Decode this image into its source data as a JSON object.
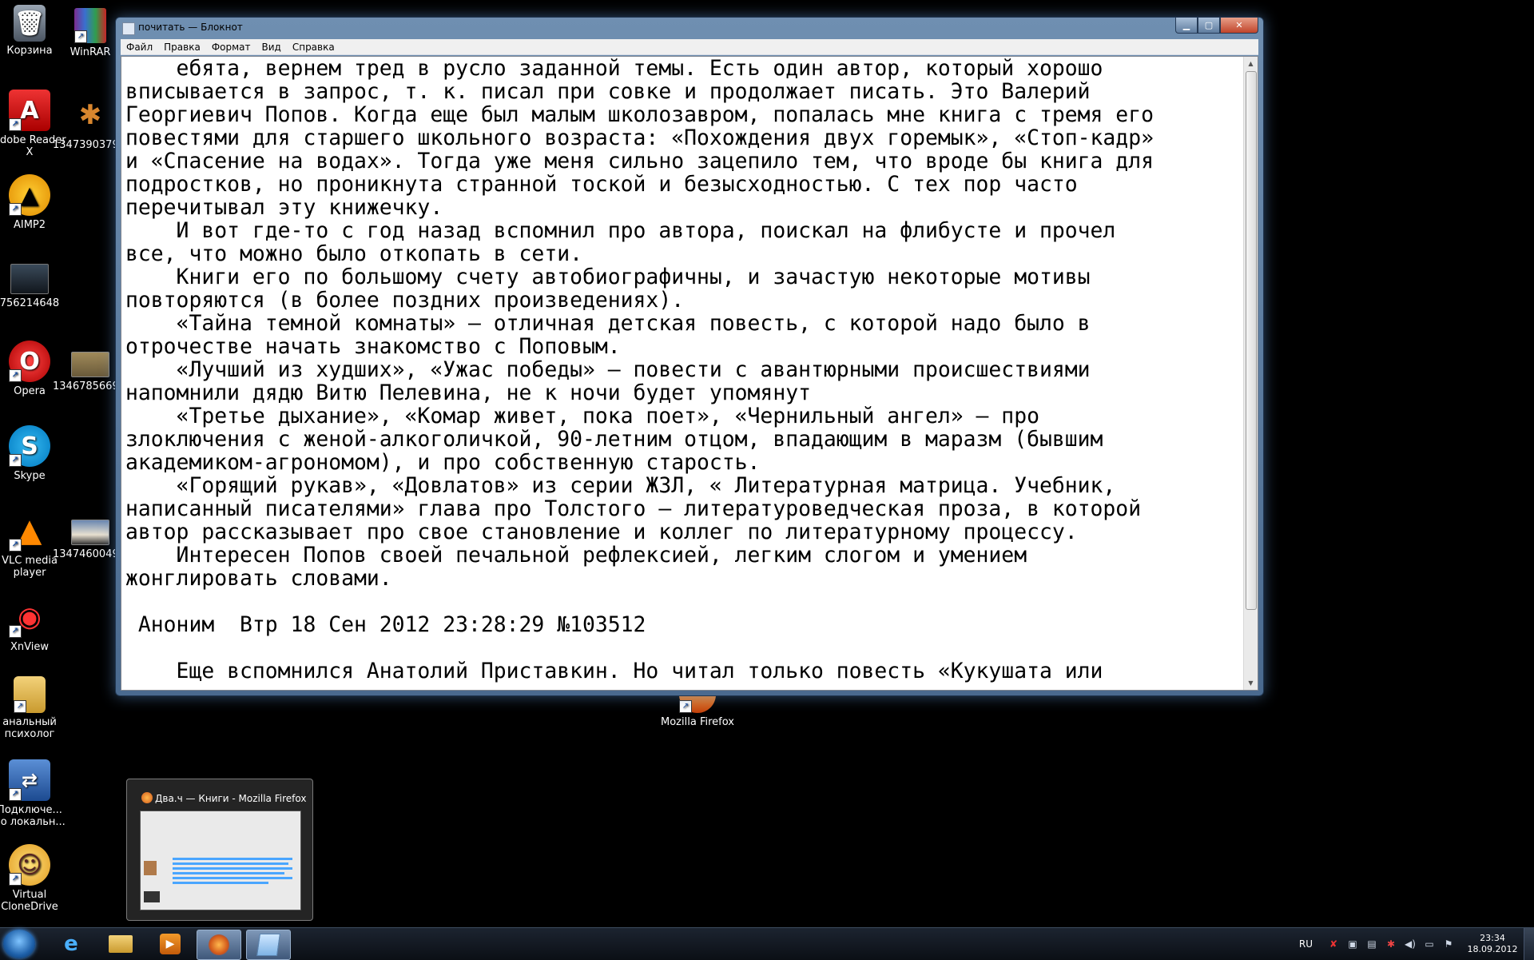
{
  "desktop": {
    "icons_left": [
      {
        "label": "Корзина",
        "icon": "recycle-bin-icon"
      },
      {
        "label": "Adobe Reader X",
        "icon": "adobe-reader-icon"
      },
      {
        "label": "AIMP2",
        "icon": "aimp-icon"
      },
      {
        "label": "756214648",
        "icon": "image-file-icon"
      },
      {
        "label": "Opera",
        "icon": "opera-icon"
      },
      {
        "label": "Skype",
        "icon": "skype-icon"
      },
      {
        "label": "VLC media player",
        "icon": "vlc-icon"
      },
      {
        "label": "XnView",
        "icon": "xnview-icon"
      },
      {
        "label": "анальный психолог",
        "icon": "folder-icon"
      },
      {
        "label": "Подключе... по локальн...",
        "icon": "network-connection-icon"
      },
      {
        "label": "Virtual CloneDrive",
        "icon": "clonedrive-icon"
      }
    ],
    "icons_second": [
      {
        "label": "WinRAR",
        "icon": "winrar-icon"
      },
      {
        "label": "1347390379...",
        "icon": "image-file-icon"
      },
      {
        "label": "1346785669...",
        "icon": "image-file-icon"
      },
      {
        "label": "1347460049...",
        "icon": "image-file-icon"
      }
    ],
    "firefox_icon": {
      "label": "Mozilla Firefox",
      "icon": "firefox-icon"
    }
  },
  "notepad": {
    "title": "почитать — Блокнот",
    "menu": [
      "Файл",
      "Правка",
      "Формат",
      "Вид",
      "Справка"
    ],
    "lines": [
      "    ебята, вернем тред в русло заданной темы. Есть один автор, который хорошо",
      "вписывается в запрос, т. к. писал при совке и продолжает писать. Это Валерий",
      "Георгиевич Попов. Когда еще был малым школозавром, попалась мне книга с тремя его",
      "повестями для старшего школьного возраста: «Похождения двух горемык», «Стоп-кадр»",
      "и «Спасение на водах». Тогда уже меня сильно зацепило тем, что вроде бы книга для",
      "подростков, но проникнута странной тоской и безысходностью. С тех пор часто",
      "перечитывал эту книжечку.",
      "    И вот где-то с год назад вспомнил про автора, поискал на флибусте и прочел",
      "все, что можно было откопать в сети.",
      "    Книги его по большому счету автобиографичны, и зачастую некоторые мотивы",
      "повторяются (в более поздних произведениях).",
      "    «Тайна темной комнаты» — отличная детская повесть, с которой надо было в",
      "отрочестве начать знакомство с Поповым.",
      "    «Лучший из худших», «Ужас победы» — повести с авантюрными происшествиями",
      "напомнили дядю Витю Пелевина, не к ночи будет упомянут",
      "    «Третье дыхание», «Комар живет, пока поет», «Чернильный ангел» — про",
      "злоключения с женой-алкоголичкой, 90-летним отцом, впадающим в маразм (бывшим",
      "академиком-агрономом), и про собственную старость.",
      "    «Горящий рукав», «Довлатов» из серии ЖЗЛ, « Литературная матрица. Учебник,",
      "написанный писателями» глава про Толстого — литературоведческая проза, в которой",
      "автор рассказывает про свое становление и коллег по литературному процессу.",
      "    Интересен Попов своей печальной рефлексией, легким слогом и умением",
      "жонглировать словами.",
      "",
      " Аноним  Втр 18 Сен 2012 23:28:29 №103512",
      "",
      "    Еще вспомнился Анатолий Приставкин. Но читал только повесть «Кукушата или"
    ]
  },
  "preview": {
    "title": "Два.ч — Книги - Mozilla Firefox"
  },
  "taskbar": {
    "lang": "RU",
    "time": "23:34",
    "date": "18.09.2012"
  }
}
